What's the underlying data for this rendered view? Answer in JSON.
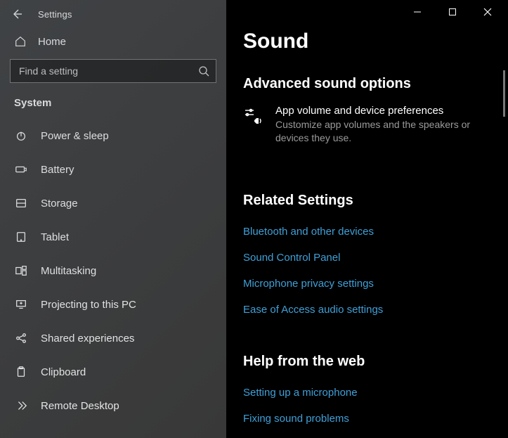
{
  "sidebar": {
    "app_title": "Settings",
    "home_label": "Home",
    "search_placeholder": "Find a setting",
    "category": "System",
    "items": [
      {
        "label": "Power & sleep",
        "icon": "power-icon"
      },
      {
        "label": "Battery",
        "icon": "battery-icon"
      },
      {
        "label": "Storage",
        "icon": "storage-icon"
      },
      {
        "label": "Tablet",
        "icon": "tablet-icon"
      },
      {
        "label": "Multitasking",
        "icon": "multitasking-icon"
      },
      {
        "label": "Projecting to this PC",
        "icon": "projecting-icon"
      },
      {
        "label": "Shared experiences",
        "icon": "shared-icon"
      },
      {
        "label": "Clipboard",
        "icon": "clipboard-icon"
      },
      {
        "label": "Remote Desktop",
        "icon": "remote-icon"
      }
    ]
  },
  "main": {
    "page_title": "Sound",
    "advanced": {
      "heading": "Advanced sound options",
      "pref_title": "App volume and device preferences",
      "pref_desc": "Customize app volumes and the speakers or devices they use."
    },
    "related": {
      "heading": "Related Settings",
      "links": [
        "Bluetooth and other devices",
        "Sound Control Panel",
        "Microphone privacy settings",
        "Ease of Access audio settings"
      ]
    },
    "help": {
      "heading": "Help from the web",
      "links": [
        "Setting up a microphone",
        "Fixing sound problems"
      ]
    }
  },
  "colors": {
    "link": "#3fa0d8",
    "muted": "#9a9a9a"
  }
}
